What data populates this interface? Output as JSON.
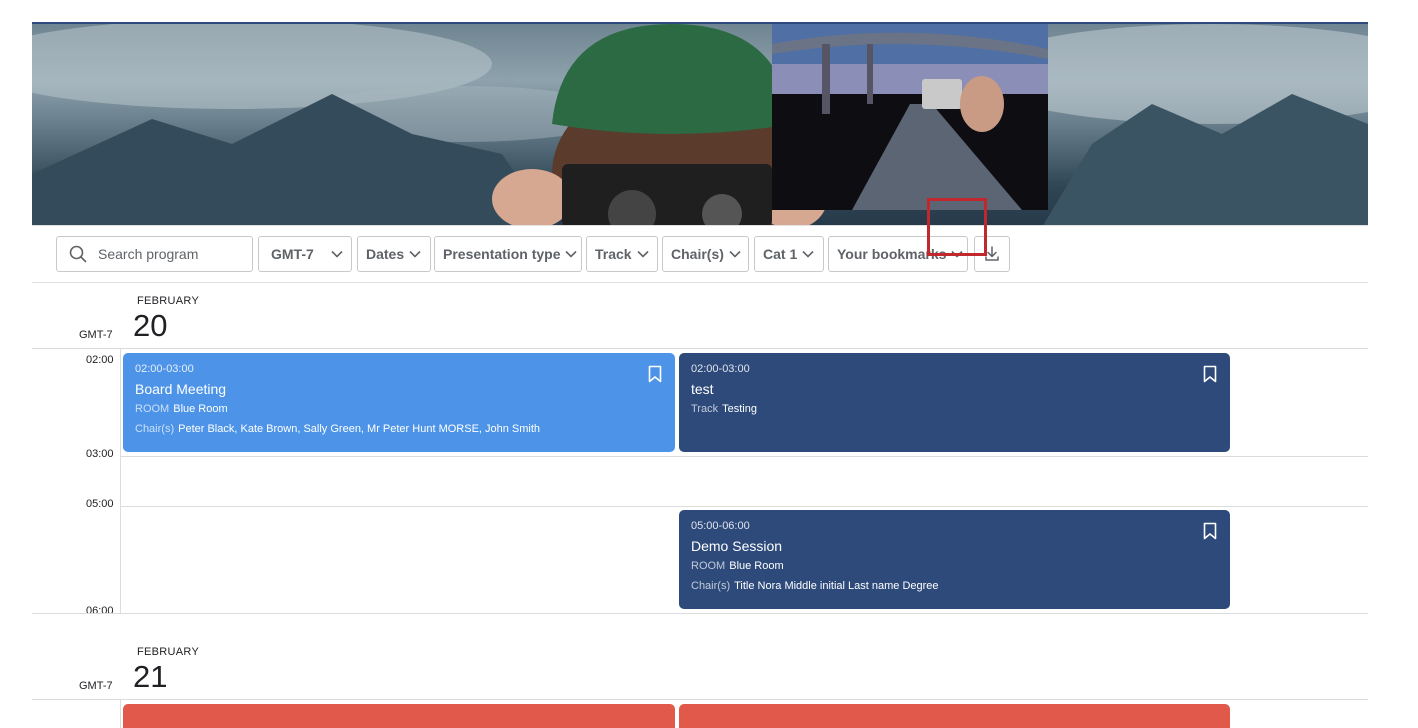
{
  "toolbar": {
    "search_placeholder": "Search program",
    "timezone_label": "GMT-7",
    "dates_label": "Dates",
    "presentation_type_label": "Presentation type",
    "track_label": "Track",
    "chairs_label": "Chair(s)",
    "cat_label": "Cat 1",
    "bookmarks_label": "Your bookmarks"
  },
  "days": [
    {
      "month": "FEBRUARY",
      "day": "20",
      "tz": "GMT-7",
      "time_labels": [
        "02:00",
        "03:00",
        "05:00",
        "06:00"
      ],
      "events": [
        {
          "time": "02:00-03:00",
          "title": "Board Meeting",
          "room_key": "ROOM",
          "room_value": "Blue Room",
          "chairs_key": "Chair(s)",
          "chairs_value": "Peter Black, Kate Brown, Sally Green, Mr Peter Hunt MORSE, John Smith"
        },
        {
          "time": "02:00-03:00",
          "title": "test",
          "track_key": "Track",
          "track_value": "Testing"
        },
        {
          "time": "05:00-06:00",
          "title": "Demo Session",
          "room_key": "ROOM",
          "room_value": "Blue Room",
          "chairs_key": "Chair(s)",
          "chairs_value": "Title Nora Middle initial Last name Degree"
        }
      ]
    },
    {
      "month": "FEBRUARY",
      "day": "21",
      "tz": "GMT-7"
    }
  ],
  "colors": {
    "event_light": "#4d94e8",
    "event_dark": "#2d4a7b",
    "event_red": "#e0594b",
    "highlight": "#c0282d"
  },
  "icons": [
    "search-icon",
    "chevron-down-icon",
    "download-icon",
    "bookmark-icon"
  ]
}
